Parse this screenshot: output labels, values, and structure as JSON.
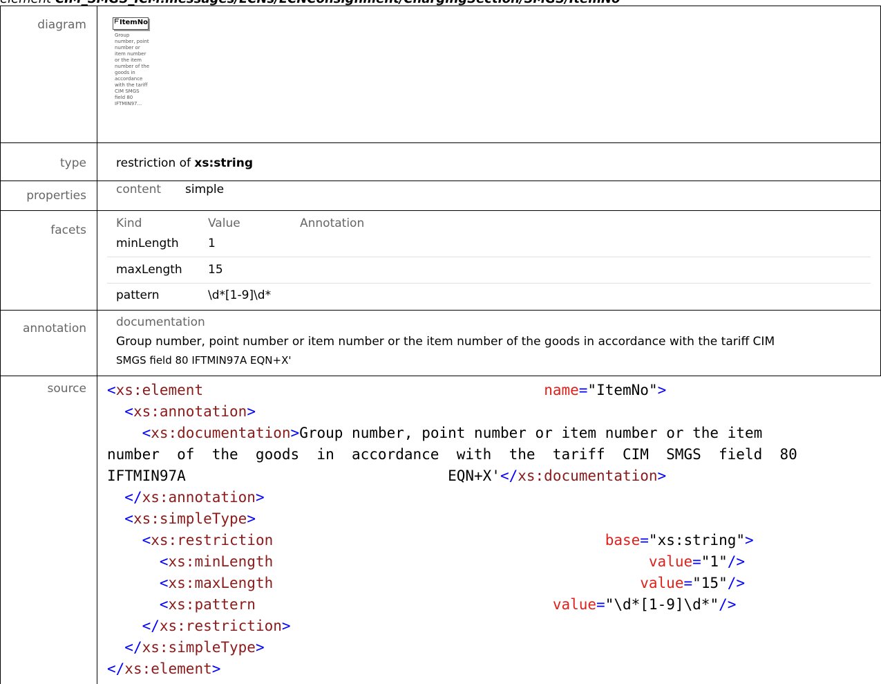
{
  "heading": {
    "label": "element",
    "path": "CIM_SMGS_ICM.messages/ECNs/ECNConsignment/ChargingSection/SMGS/ItemNo"
  },
  "labels": {
    "diagram": "diagram",
    "type": "type",
    "properties": "properties",
    "facets": "facets",
    "annotation": "annotation",
    "source": "source"
  },
  "diagram": {
    "element_name": "ItemNo",
    "note": "Group number, point number or item number or the item number of the goods in accordance with the tariff CIM SMGS field 80 IFTMIN97..."
  },
  "type": {
    "prefix": "restriction of",
    "base": "xs:string"
  },
  "properties": {
    "key": "content",
    "value": "simple"
  },
  "facets": {
    "headers": [
      "Kind",
      "Value",
      "Annotation"
    ],
    "rows": [
      {
        "kind": "minLength",
        "value": "1"
      },
      {
        "kind": "maxLength",
        "value": "15"
      },
      {
        "kind": "pattern",
        "value": "\\d*[1-9]\\d*"
      }
    ]
  },
  "annotation": {
    "label": "documentation",
    "line1": "Group number, point number or item number or the item number of the goods in accordance with the tariff CIM",
    "line2": "SMGS field 80 IFTMIN97A EQN+X'"
  },
  "source": {
    "element_tag": "xs:element",
    "name_attr": "name",
    "name_value": "ItemNo",
    "annotation_tag": "xs:annotation",
    "documentation_tag": "xs:documentation",
    "doc_line1": "Group number, point number or item number or the item",
    "doc_line2": "number  of  the  goods  in  accordance  with  the  tariff  CIM  SMGS  field  80",
    "doc_line3a": "IFTMIN97A",
    "doc_line3b": "EQN+X'",
    "simpletype_tag": "xs:simpleType",
    "restriction_tag": "xs:restriction",
    "base_attr": "base",
    "base_value": "xs:string",
    "minlength_tag": "xs:minLength",
    "maxlength_tag": "xs:maxLength",
    "pattern_tag": "xs:pattern",
    "value_attr": "value",
    "min_value": "1",
    "max_value": "15",
    "pattern_value": "\\d*[1-9]\\d*"
  },
  "colors": {
    "tag": "#8b1a1a",
    "bracket": "#0000ff",
    "attribute": "#e0201a",
    "label_grey": "#666666"
  }
}
